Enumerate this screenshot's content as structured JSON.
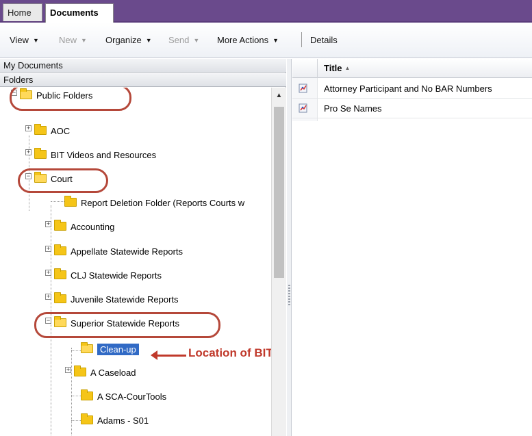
{
  "tabs": {
    "home": "Home",
    "documents": "Documents"
  },
  "toolbar": {
    "view": "View",
    "new": "New",
    "organize": "Organize",
    "send": "Send",
    "more_actions": "More Actions",
    "details": "Details",
    "dropdown_glyph": "▼"
  },
  "left_panel": {
    "my_documents": "My Documents",
    "folders": "Folders"
  },
  "tree": {
    "public_folders": "Public Folders",
    "aoc": "AOC",
    "bit_videos": "BIT Videos and Resources",
    "court": "Court",
    "report_deletion": "Report Deletion Folder (Reports Courts w",
    "accounting": "Accounting",
    "appellate": "Appellate Statewide Reports",
    "clj": "CLJ Statewide Reports",
    "juvenile": "Juvenile Statewide Reports",
    "superior": "Superior Statewide Reports",
    "cleanup": "Clean-up",
    "a_caseload": "A Caseload",
    "a_sca": "A SCA-CourTools",
    "adams": "Adams - S01"
  },
  "annotation": {
    "text": "Location of BIT Clean-Up queries",
    "color": "#c0392b"
  },
  "list": {
    "column_title": "Title",
    "sort_glyph": "▲",
    "rows": [
      {
        "title": "Attorney Participant and No BAR Numbers",
        "icon": "webi-report-icon"
      },
      {
        "title": "Pro Se Names",
        "icon": "webi-report-icon"
      }
    ]
  },
  "colors": {
    "tabbar": "#6a4a8c",
    "highlight_ring": "#b5483a",
    "selection": "#316ac5",
    "folder": "#f5c518"
  }
}
